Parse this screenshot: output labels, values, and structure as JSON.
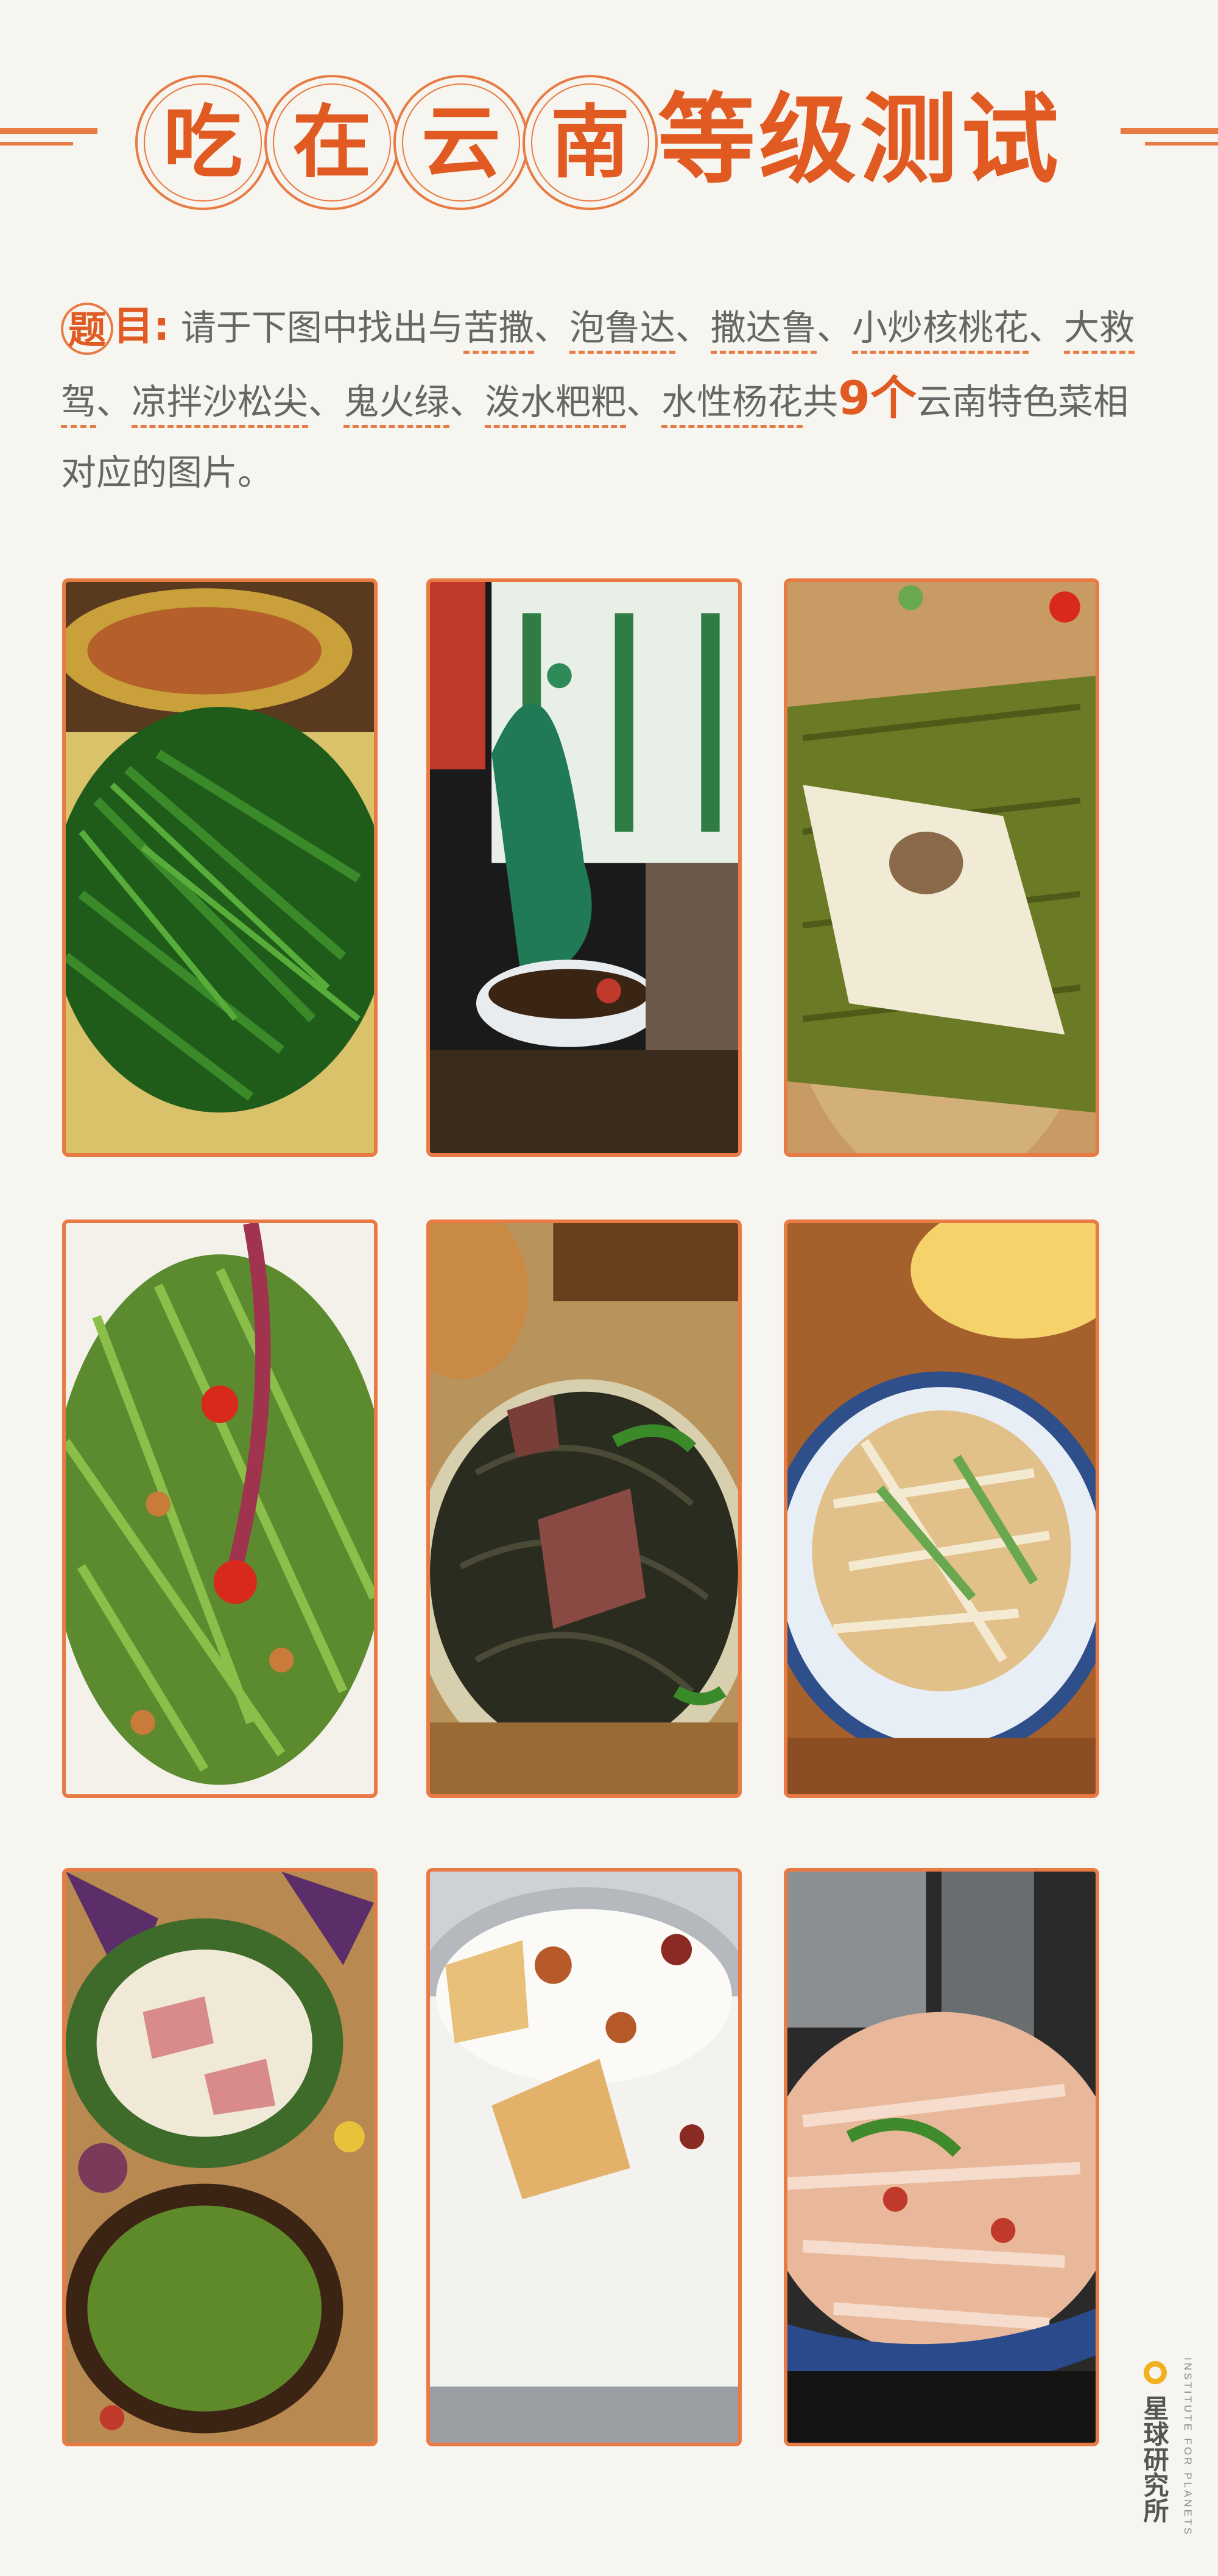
{
  "title": {
    "circle_chars": [
      "吃",
      "在",
      "云",
      "南"
    ],
    "rest": "等级测试"
  },
  "question": {
    "label": [
      "题",
      "目"
    ],
    "label_colon": ":",
    "intro": "请于下图中找出与",
    "dishes": [
      "苦撒",
      "泡鲁达",
      "撒达鲁",
      "小炒核桃花",
      "大救驾",
      "凉拌沙松尖",
      "鬼火绿",
      "泼水粑粑",
      "水性杨花"
    ],
    "separator": "、",
    "total_prefix": "共",
    "count": "9个",
    "suffix": "云南特色菜相对应的图片。"
  },
  "photos": [
    {
      "subject": "stir-fried green stems with meat sauce"
    },
    {
      "subject": "peacock sculpture with dipping bowl and sliced beef"
    },
    {
      "subject": "rice cake in banana leaf"
    },
    {
      "subject": "green fern salad with chili"
    },
    {
      "subject": "dark noodles with sliced beef"
    },
    {
      "subject": "stir-fried shredded vegetables on blue plate"
    },
    {
      "subject": "sliced meat platter with herb dip"
    },
    {
      "subject": "coconut milk dessert with bread"
    },
    {
      "subject": "stir-fried flat rice noodles"
    }
  ],
  "logo": {
    "name": "星球研究所",
    "english": "INSTITUTE FOR PLANETS"
  },
  "colors": {
    "accent": "#e05a22",
    "border": "#e87b43",
    "logo_ring": "#f2b01e"
  }
}
